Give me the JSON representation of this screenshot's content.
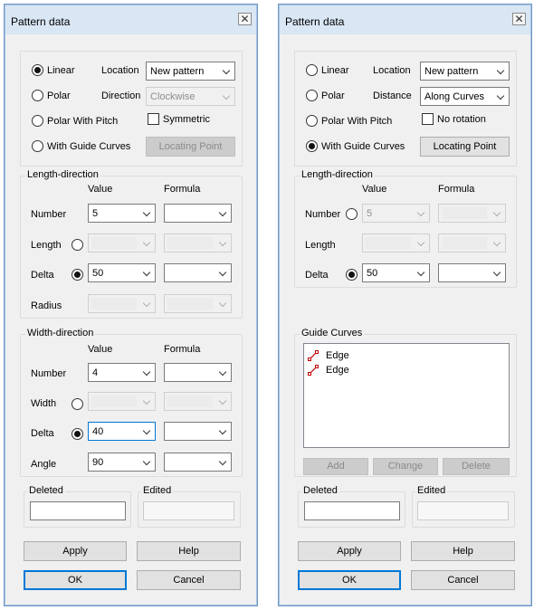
{
  "dialogs": [
    {
      "title": "Pattern data",
      "type": {
        "linear": "Linear",
        "polar": "Polar",
        "polar_pitch": "Polar With Pitch",
        "guide_curves": "With Guide Curves",
        "selected": "Linear"
      },
      "location_label": "Location",
      "location_value": "New pattern",
      "direction_label": "Direction",
      "direction_value": "Clockwise",
      "symmetric_label": "Symmetric",
      "locating_point": "Locating Point",
      "length_direction": {
        "title": "Length-direction",
        "value_header": "Value",
        "formula_header": "Formula",
        "number_label": "Number",
        "number_value": "5",
        "length_label": "Length",
        "delta_label": "Delta",
        "delta_value": "50",
        "radius_label": "Radius"
      },
      "width_direction": {
        "title": "Width-direction",
        "value_header": "Value",
        "formula_header": "Formula",
        "number_label": "Number",
        "number_value": "4",
        "width_label": "Width",
        "delta_label": "Delta",
        "delta_value": "40",
        "angle_label": "Angle",
        "angle_value": "90"
      },
      "deleted_label": "Deleted",
      "edited_label": "Edited",
      "apply": "Apply",
      "help": "Help",
      "ok": "OK",
      "cancel": "Cancel"
    },
    {
      "title": "Pattern data",
      "type": {
        "linear": "Linear",
        "polar": "Polar",
        "polar_pitch": "Polar With Pitch",
        "guide_curves": "With Guide Curves",
        "selected": "With Guide Curves"
      },
      "location_label": "Location",
      "location_value": "New pattern",
      "distance_label": "Distance",
      "distance_value": "Along Curves",
      "no_rotation_label": "No rotation",
      "locating_point": "Locating Point",
      "length_direction": {
        "title": "Length-direction",
        "value_header": "Value",
        "formula_header": "Formula",
        "number_label": "Number",
        "number_value": "5",
        "length_label": "Length",
        "delta_label": "Delta",
        "delta_value": "50"
      },
      "guide_curves": {
        "title": "Guide Curves",
        "items": [
          "Edge",
          "Edge"
        ],
        "add": "Add",
        "change": "Change",
        "delete": "Delete"
      },
      "deleted_label": "Deleted",
      "edited_label": "Edited",
      "apply": "Apply",
      "help": "Help",
      "ok": "OK",
      "cancel": "Cancel"
    }
  ]
}
